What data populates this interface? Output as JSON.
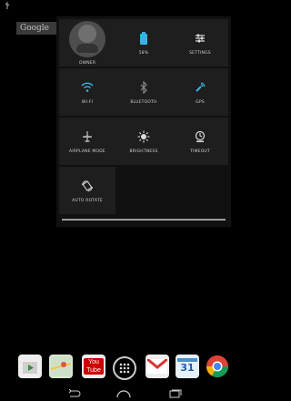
{
  "status_bar": {
    "icon": "usb-debug-icon"
  },
  "search": {
    "label": "Google"
  },
  "quick_settings": {
    "tiles": [
      {
        "id": "owner",
        "label": "OWNER",
        "icon": "user-avatar"
      },
      {
        "id": "battery",
        "label": "58%",
        "icon": "battery-icon"
      },
      {
        "id": "settings",
        "label": "SETTINGS",
        "icon": "settings-sliders-icon"
      },
      {
        "id": "wifi",
        "label": "WI-FI",
        "icon": "wifi-icon"
      },
      {
        "id": "bluetooth",
        "label": "BLUETOOTH",
        "icon": "bluetooth-icon"
      },
      {
        "id": "gps",
        "label": "GPS",
        "icon": "gps-icon"
      },
      {
        "id": "airplane",
        "label": "AIRPLANE MODE",
        "icon": "airplane-icon"
      },
      {
        "id": "brightness",
        "label": "BRIGHTNESS",
        "icon": "brightness-icon"
      },
      {
        "id": "timeout",
        "label": "TIMEOUT",
        "icon": "timeout-icon"
      },
      {
        "id": "autorotate",
        "label": "AUTO ROTATE",
        "icon": "auto-rotate-icon"
      }
    ]
  },
  "dock": {
    "apps": [
      {
        "name": "play-store-icon",
        "label": ""
      },
      {
        "name": "maps-icon",
        "label": ""
      },
      {
        "name": "youtube-icon",
        "label": "You\nTube"
      },
      {
        "name": "app-drawer-icon",
        "label": ""
      },
      {
        "name": "gmail-icon",
        "label": ""
      },
      {
        "name": "calendar-icon",
        "label": "31"
      },
      {
        "name": "chrome-icon",
        "label": ""
      }
    ]
  },
  "nav": {
    "back": "back-icon",
    "home": "home-icon",
    "recents": "recents-icon"
  },
  "colors": {
    "accent": "#33b5e5",
    "tile_bg": "#1e1e1e",
    "panel_bg": "#111111"
  }
}
